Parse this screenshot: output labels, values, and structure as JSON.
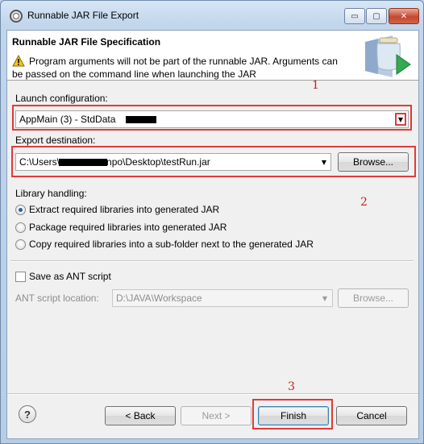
{
  "window": {
    "title": "Runnable JAR File Export",
    "minimize": "▭",
    "maximize": "▢",
    "close": "✕"
  },
  "header": {
    "page_title": "Runnable JAR File Specification",
    "message": "Program arguments will not be part of the runnable JAR. Arguments can be passed on the command line when launching the JAR"
  },
  "annotations": [
    "1",
    "2",
    "3"
  ],
  "launch": {
    "label": "Launch configuration:",
    "value": "AppMain (3) - StdData"
  },
  "export": {
    "label": "Export destination:",
    "value_prefix": "C:\\Users\\",
    "value_suffix": "npo\\Desktop\\testRun.jar",
    "browse": "Browse..."
  },
  "library": {
    "label": "Library handling:",
    "options": [
      {
        "label": "Extract required libraries into generated JAR",
        "selected": true
      },
      {
        "label": "Package required libraries into generated JAR",
        "selected": false
      },
      {
        "label": "Copy required libraries into a sub-folder next to the generated JAR",
        "selected": false
      }
    ]
  },
  "ant": {
    "save_label": "Save as ANT script",
    "checked": false,
    "location_label": "ANT script location:",
    "location_value": "D:\\JAVA\\Workspace",
    "browse": "Browse..."
  },
  "footer": {
    "help": "?",
    "back": "< Back",
    "next": "Next >",
    "finish": "Finish",
    "cancel": "Cancel"
  },
  "colors": {
    "annotation_red": "#e03a3a",
    "selection_accent": "#2f5f9a"
  }
}
